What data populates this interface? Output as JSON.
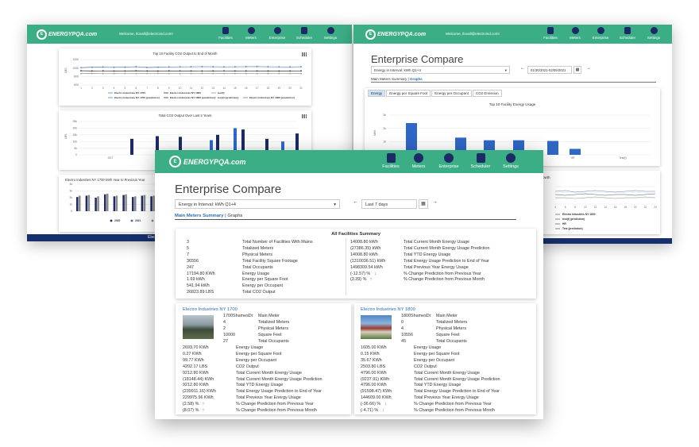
{
  "brand": {
    "logo_text": "ENERGYPQA.com",
    "logo_letter": "E",
    "color_topbar": "#3cae86",
    "color_nav_icon": "#1c2a66",
    "color_footer": "#17306b"
  },
  "nav": {
    "items": [
      "Facilities",
      "Meters",
      "Enterprise",
      "Scheduler",
      "Settings"
    ]
  },
  "back_left": {
    "welcome": "Welcome, tlovall@electroind.com!",
    "footer_text": "Electr",
    "chart1": {
      "title": "Top 10 Facility CO2 Output to End of Month",
      "y_ticks": [
        "1200",
        "1000",
        "800",
        "600"
      ],
      "ylabel": "LBS",
      "x_ticks": [
        "1",
        "2",
        "3",
        "4",
        "5",
        "6",
        "7",
        "8",
        "9",
        "10",
        "11",
        "12",
        "13",
        "14",
        "15",
        "16",
        "17",
        "18",
        "19",
        "20",
        "21"
      ],
      "legend": [
        "Electro Industries NY 1700",
        "Electro Industries NY 1800",
        "test(t)",
        "Electro Industries NY 1700 (prediction)",
        "Electro Industries NY 1800 (prediction)",
        "test(t) (prediction)",
        "Electro Industries NY 1800 (prediction)"
      ],
      "series": [
        {
          "name": "Electro Industries NY 1700",
          "values": [
            1010,
            1020,
            1025,
            1018,
            1022,
            1030,
            1015,
            1020,
            1025,
            1028,
            1030,
            1032,
            1030,
            1028,
            1030,
            1032,
            1035,
            1030,
            1028,
            1025,
            1030
          ]
        },
        {
          "name": "Electro Industries NY 1800",
          "values": [
            935,
            930,
            932,
            928,
            930,
            933,
            930,
            928,
            932,
            930,
            931,
            929,
            930,
            932,
            930,
            929,
            931,
            930,
            928,
            930,
            932
          ]
        },
        {
          "name": "test(t)",
          "values": [
            870,
            872,
            868,
            870,
            871,
            869,
            870,
            872,
            870,
            868,
            870,
            871,
            869,
            870,
            872,
            870,
            868,
            870,
            871,
            869,
            870
          ]
        }
      ]
    },
    "chart2": {
      "title": "Total CO2 Output Over Last 3 Years",
      "y_ticks": [
        "25k",
        "20k",
        "15k",
        "10k",
        "5k",
        "0"
      ],
      "ylabel": "LBS",
      "x_ticks": [
        "2017",
        "2018",
        "2019",
        "2020"
      ],
      "legend": "Electro Indu",
      "series": [
        {
          "name": "",
          "values": [
            12000,
            14000,
            13500,
            11000,
            15000,
            20000,
            19000,
            12000,
            10000,
            16000
          ]
        }
      ]
    },
    "chart3": {
      "title": "Electro Industries NY 1700 kWh Year to Previous Year",
      "y_ticks": [
        "4k",
        "3k",
        "2k",
        "1k",
        "0"
      ],
      "legend": [
        "2020",
        "2021",
        "2021 (Predicted)"
      ],
      "series": [
        {
          "name": "2020",
          "values": [
            2100,
            2300,
            2000,
            2500,
            2200,
            2400,
            2100,
            2300,
            2200,
            2600,
            2400,
            2300
          ]
        },
        {
          "name": "2021",
          "values": [
            2300,
            2400,
            2200,
            2600,
            2300,
            2500,
            2200,
            2400,
            2300,
            2700,
            2500,
            2400
          ]
        }
      ]
    }
  },
  "back_right": {
    "welcome": "Welcome, tlovall@electroind.com!",
    "page_title": "Enterprise Compare",
    "select_value": "Energy in Interval: kWh Q1+4",
    "date_range": "01/30/2021-02/05/2021",
    "links": {
      "summary": "Main Meters Summary",
      "sep": "|",
      "graphs": "Graphs"
    },
    "tabs": [
      "Energy",
      "Energy per Square Foot",
      "Energy per Occupant",
      "CO2 Emission"
    ],
    "chart": {
      "title": "Top 10 Facility Energy Usage",
      "y_ticks": [
        "3k",
        "2k",
        "1k",
        "0"
      ],
      "ylabel": "kWh",
      "x_ticks": [
        "NY 1700",
        "NY 1800",
        "test(t)",
        "HR",
        "Test(t)"
      ],
      "values": [
        2400,
        1300,
        1100,
        1100,
        1050,
        450
      ],
      "ylim": [
        0,
        3000
      ]
    },
    "chart2_title_fragment": "owth",
    "chart2": {
      "legend": [
        "Electro Industries NY 1800",
        "test(t) (prediction)",
        "HR",
        "Test (prediction)"
      ],
      "x_ticks": [
        "4",
        "6",
        "8",
        "10",
        "12",
        "14",
        "16",
        "18",
        "20",
        "22",
        "24"
      ]
    }
  },
  "front": {
    "page_title": "Enterprise Compare",
    "select_value": "Energy in Interval: kWh Q1+4",
    "date_value": "Last 7 days",
    "links": {
      "summary": "Main Meters Summary",
      "sep": "|",
      "graphs": "Graphs"
    },
    "summary": {
      "title": "All Facilities Summary",
      "left_values": [
        "3",
        "5",
        "7",
        "36556",
        "247",
        "17194.80 KWh",
        "1.69 kWh",
        "541.94 kWh",
        "26823.89 LBS"
      ],
      "left_labels": [
        "Total Number of Facilities With Mains",
        "Totalized Meters",
        "Physical Meters",
        "Total Facility Square Footage",
        "Total Occupants",
        "Energy Usage",
        "Energy per Square Foot",
        "Energy per Occupant",
        "Total CO2 Output"
      ],
      "right_values": [
        "14008.80 kWh",
        "(27386.35) kWh",
        "14008.80 kWh",
        "(1310036.51) kWh",
        "1498309.54 kWh",
        "(-12.57) %",
        "(3.39) %"
      ],
      "right_labels": [
        "Total Current Month Energy Usage",
        "Total Current Month Energy Usage Prediction",
        "Total YTD Energy Usage",
        "Total Energy Usage Prediction to End of Year",
        "Total Previous Year Energy Usage",
        "% Change Prediction from Previous Year",
        "% Change Prediction from Previous Month"
      ]
    },
    "facility1": {
      "name": "Electro Industries NY 1700",
      "top_values": [
        "1700ShamesDr",
        "4",
        "2",
        "10000",
        "27"
      ],
      "top_labels": [
        "Main Meter",
        "Totalized Meters",
        "Physical Meters",
        "Square Feet",
        "Total Occupants"
      ],
      "values": [
        "2693.70 KWh",
        "0.27 KWh",
        "99.77 KWh",
        "4202.17 LBS",
        "9212.80 KWh",
        "(18148.44) KWh",
        "9212.80 KWh",
        "(239911.16) KWh",
        "229975.96 KWh",
        "(2.58) %",
        "(8.07) %"
      ],
      "labels": [
        "Energy Usage",
        "Energy per Square Foot",
        "Energy per Occupant",
        "CO2 Output",
        "Total Current Month Energy Usage",
        "Total Current Month Energy Usage Prediction",
        "Total YTD Energy Usage",
        "Total Energy Usage Prediction to End of Year",
        "Total Previous Year Energy Usage",
        "% Change Prediction from Previous Year",
        "% Change Prediction from Previous Month"
      ]
    },
    "facility2": {
      "name": "Electro Industries NY 1800",
      "top_values": [
        "1800ShamesDr",
        "0",
        "4",
        "10556",
        "45"
      ],
      "top_labels": [
        "Main Meter",
        "Totalized Meters",
        "Physical Meters",
        "Square Feet",
        "Total Occupants"
      ],
      "values": [
        "1605.00 KWh",
        "0.15 KWh",
        "35.67 KWh",
        "2503.80 LBS",
        "4796.00 KWh",
        "(9237.91) KWh",
        "4796.00 KWh",
        "(91598.47) KWh",
        "144609.00 KWh",
        "(-36.66) %",
        "(-4.71) %"
      ],
      "labels": [
        "Energy Usage",
        "Energy per Square Foot",
        "Energy per Occupant",
        "CO2 Output",
        "Total Current Month Energy Usage",
        "Total Current Month Energy Usage Prediction",
        "Total YTD Energy Usage",
        "Total Energy Usage Prediction to End of Year",
        "Total Previous Year Energy Usage",
        "% Change Prediction from Previous Year",
        "% Change Prediction from Previous Month"
      ]
    }
  }
}
